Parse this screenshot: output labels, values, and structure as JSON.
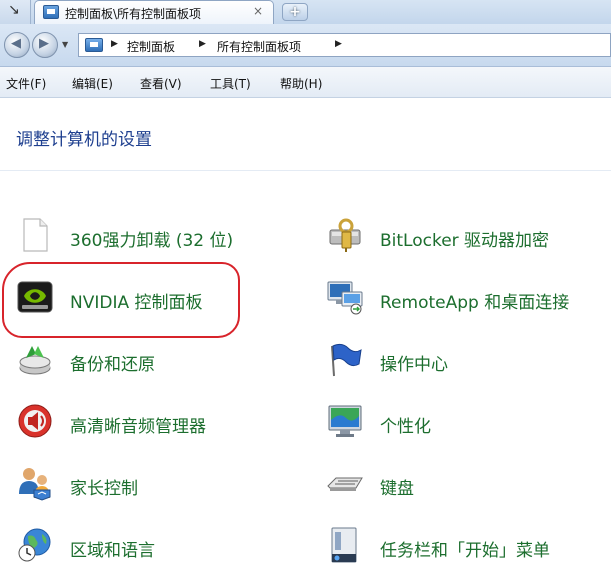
{
  "tab": {
    "title": "控制面板\\所有控制面板项",
    "close_glyph": "×",
    "new_tab_glyph": "+"
  },
  "address": {
    "crumbs": [
      "控制面板",
      "所有控制面板项"
    ],
    "separator": "▶"
  },
  "menu": [
    "文件(F)",
    "编辑(E)",
    "查看(V)",
    "工具(T)",
    "帮助(H)"
  ],
  "page": {
    "title": "调整计算机的设置"
  },
  "items": {
    "left": [
      {
        "label": "360强力卸载 (32 位)",
        "icon": "blank-document-icon"
      },
      {
        "label": "NVIDIA 控制面板",
        "icon": "nvidia-icon"
      },
      {
        "label": "备份和还原",
        "icon": "backup-restore-icon"
      },
      {
        "label": "高清晰音频管理器",
        "icon": "audio-speaker-icon"
      },
      {
        "label": "家长控制",
        "icon": "parental-controls-icon"
      },
      {
        "label": "区域和语言",
        "icon": "globe-clock-icon"
      }
    ],
    "right": [
      {
        "label": "BitLocker 驱动器加密",
        "icon": "bitlocker-key-icon"
      },
      {
        "label": "RemoteApp 和桌面连接",
        "icon": "remoteapp-icon"
      },
      {
        "label": "操作中心",
        "icon": "action-center-flag-icon"
      },
      {
        "label": "个性化",
        "icon": "personalization-monitor-icon"
      },
      {
        "label": "键盘",
        "icon": "keyboard-icon"
      },
      {
        "label": "任务栏和「开始」菜单",
        "icon": "taskbar-icon"
      }
    ]
  },
  "colors": {
    "link_green": "#1c6e2e",
    "title_blue": "#1e3f8f",
    "annotation_red": "#d8242b"
  }
}
